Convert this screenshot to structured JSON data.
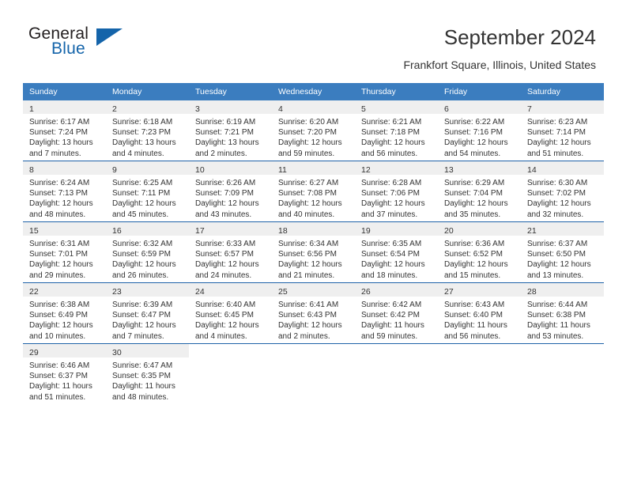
{
  "brand": {
    "line1": "General",
    "line2": "Blue",
    "flag_color": "#1464aa"
  },
  "header": {
    "title": "September 2024",
    "subtitle": "Frankfort Square, Illinois, United States",
    "header_bg": "#3b7dbf",
    "grid_line_color": "#1f62a8",
    "daynum_band_color": "#efefef"
  },
  "weekdays": [
    "Sunday",
    "Monday",
    "Tuesday",
    "Wednesday",
    "Thursday",
    "Friday",
    "Saturday"
  ],
  "weeks": [
    [
      {
        "day": "1",
        "sunrise": "Sunrise: 6:17 AM",
        "sunset": "Sunset: 7:24 PM",
        "daylight1": "Daylight: 13 hours",
        "daylight2": "and 7 minutes."
      },
      {
        "day": "2",
        "sunrise": "Sunrise: 6:18 AM",
        "sunset": "Sunset: 7:23 PM",
        "daylight1": "Daylight: 13 hours",
        "daylight2": "and 4 minutes."
      },
      {
        "day": "3",
        "sunrise": "Sunrise: 6:19 AM",
        "sunset": "Sunset: 7:21 PM",
        "daylight1": "Daylight: 13 hours",
        "daylight2": "and 2 minutes."
      },
      {
        "day": "4",
        "sunrise": "Sunrise: 6:20 AM",
        "sunset": "Sunset: 7:20 PM",
        "daylight1": "Daylight: 12 hours",
        "daylight2": "and 59 minutes."
      },
      {
        "day": "5",
        "sunrise": "Sunrise: 6:21 AM",
        "sunset": "Sunset: 7:18 PM",
        "daylight1": "Daylight: 12 hours",
        "daylight2": "and 56 minutes."
      },
      {
        "day": "6",
        "sunrise": "Sunrise: 6:22 AM",
        "sunset": "Sunset: 7:16 PM",
        "daylight1": "Daylight: 12 hours",
        "daylight2": "and 54 minutes."
      },
      {
        "day": "7",
        "sunrise": "Sunrise: 6:23 AM",
        "sunset": "Sunset: 7:14 PM",
        "daylight1": "Daylight: 12 hours",
        "daylight2": "and 51 minutes."
      }
    ],
    [
      {
        "day": "8",
        "sunrise": "Sunrise: 6:24 AM",
        "sunset": "Sunset: 7:13 PM",
        "daylight1": "Daylight: 12 hours",
        "daylight2": "and 48 minutes."
      },
      {
        "day": "9",
        "sunrise": "Sunrise: 6:25 AM",
        "sunset": "Sunset: 7:11 PM",
        "daylight1": "Daylight: 12 hours",
        "daylight2": "and 45 minutes."
      },
      {
        "day": "10",
        "sunrise": "Sunrise: 6:26 AM",
        "sunset": "Sunset: 7:09 PM",
        "daylight1": "Daylight: 12 hours",
        "daylight2": "and 43 minutes."
      },
      {
        "day": "11",
        "sunrise": "Sunrise: 6:27 AM",
        "sunset": "Sunset: 7:08 PM",
        "daylight1": "Daylight: 12 hours",
        "daylight2": "and 40 minutes."
      },
      {
        "day": "12",
        "sunrise": "Sunrise: 6:28 AM",
        "sunset": "Sunset: 7:06 PM",
        "daylight1": "Daylight: 12 hours",
        "daylight2": "and 37 minutes."
      },
      {
        "day": "13",
        "sunrise": "Sunrise: 6:29 AM",
        "sunset": "Sunset: 7:04 PM",
        "daylight1": "Daylight: 12 hours",
        "daylight2": "and 35 minutes."
      },
      {
        "day": "14",
        "sunrise": "Sunrise: 6:30 AM",
        "sunset": "Sunset: 7:02 PM",
        "daylight1": "Daylight: 12 hours",
        "daylight2": "and 32 minutes."
      }
    ],
    [
      {
        "day": "15",
        "sunrise": "Sunrise: 6:31 AM",
        "sunset": "Sunset: 7:01 PM",
        "daylight1": "Daylight: 12 hours",
        "daylight2": "and 29 minutes."
      },
      {
        "day": "16",
        "sunrise": "Sunrise: 6:32 AM",
        "sunset": "Sunset: 6:59 PM",
        "daylight1": "Daylight: 12 hours",
        "daylight2": "and 26 minutes."
      },
      {
        "day": "17",
        "sunrise": "Sunrise: 6:33 AM",
        "sunset": "Sunset: 6:57 PM",
        "daylight1": "Daylight: 12 hours",
        "daylight2": "and 24 minutes."
      },
      {
        "day": "18",
        "sunrise": "Sunrise: 6:34 AM",
        "sunset": "Sunset: 6:56 PM",
        "daylight1": "Daylight: 12 hours",
        "daylight2": "and 21 minutes."
      },
      {
        "day": "19",
        "sunrise": "Sunrise: 6:35 AM",
        "sunset": "Sunset: 6:54 PM",
        "daylight1": "Daylight: 12 hours",
        "daylight2": "and 18 minutes."
      },
      {
        "day": "20",
        "sunrise": "Sunrise: 6:36 AM",
        "sunset": "Sunset: 6:52 PM",
        "daylight1": "Daylight: 12 hours",
        "daylight2": "and 15 minutes."
      },
      {
        "day": "21",
        "sunrise": "Sunrise: 6:37 AM",
        "sunset": "Sunset: 6:50 PM",
        "daylight1": "Daylight: 12 hours",
        "daylight2": "and 13 minutes."
      }
    ],
    [
      {
        "day": "22",
        "sunrise": "Sunrise: 6:38 AM",
        "sunset": "Sunset: 6:49 PM",
        "daylight1": "Daylight: 12 hours",
        "daylight2": "and 10 minutes."
      },
      {
        "day": "23",
        "sunrise": "Sunrise: 6:39 AM",
        "sunset": "Sunset: 6:47 PM",
        "daylight1": "Daylight: 12 hours",
        "daylight2": "and 7 minutes."
      },
      {
        "day": "24",
        "sunrise": "Sunrise: 6:40 AM",
        "sunset": "Sunset: 6:45 PM",
        "daylight1": "Daylight: 12 hours",
        "daylight2": "and 4 minutes."
      },
      {
        "day": "25",
        "sunrise": "Sunrise: 6:41 AM",
        "sunset": "Sunset: 6:43 PM",
        "daylight1": "Daylight: 12 hours",
        "daylight2": "and 2 minutes."
      },
      {
        "day": "26",
        "sunrise": "Sunrise: 6:42 AM",
        "sunset": "Sunset: 6:42 PM",
        "daylight1": "Daylight: 11 hours",
        "daylight2": "and 59 minutes."
      },
      {
        "day": "27",
        "sunrise": "Sunrise: 6:43 AM",
        "sunset": "Sunset: 6:40 PM",
        "daylight1": "Daylight: 11 hours",
        "daylight2": "and 56 minutes."
      },
      {
        "day": "28",
        "sunrise": "Sunrise: 6:44 AM",
        "sunset": "Sunset: 6:38 PM",
        "daylight1": "Daylight: 11 hours",
        "daylight2": "and 53 minutes."
      }
    ],
    [
      {
        "day": "29",
        "sunrise": "Sunrise: 6:46 AM",
        "sunset": "Sunset: 6:37 PM",
        "daylight1": "Daylight: 11 hours",
        "daylight2": "and 51 minutes."
      },
      {
        "day": "30",
        "sunrise": "Sunrise: 6:47 AM",
        "sunset": "Sunset: 6:35 PM",
        "daylight1": "Daylight: 11 hours",
        "daylight2": "and 48 minutes."
      },
      {
        "day": "",
        "sunrise": "",
        "sunset": "",
        "daylight1": "",
        "daylight2": ""
      },
      {
        "day": "",
        "sunrise": "",
        "sunset": "",
        "daylight1": "",
        "daylight2": ""
      },
      {
        "day": "",
        "sunrise": "",
        "sunset": "",
        "daylight1": "",
        "daylight2": ""
      },
      {
        "day": "",
        "sunrise": "",
        "sunset": "",
        "daylight1": "",
        "daylight2": ""
      },
      {
        "day": "",
        "sunrise": "",
        "sunset": "",
        "daylight1": "",
        "daylight2": ""
      }
    ]
  ]
}
